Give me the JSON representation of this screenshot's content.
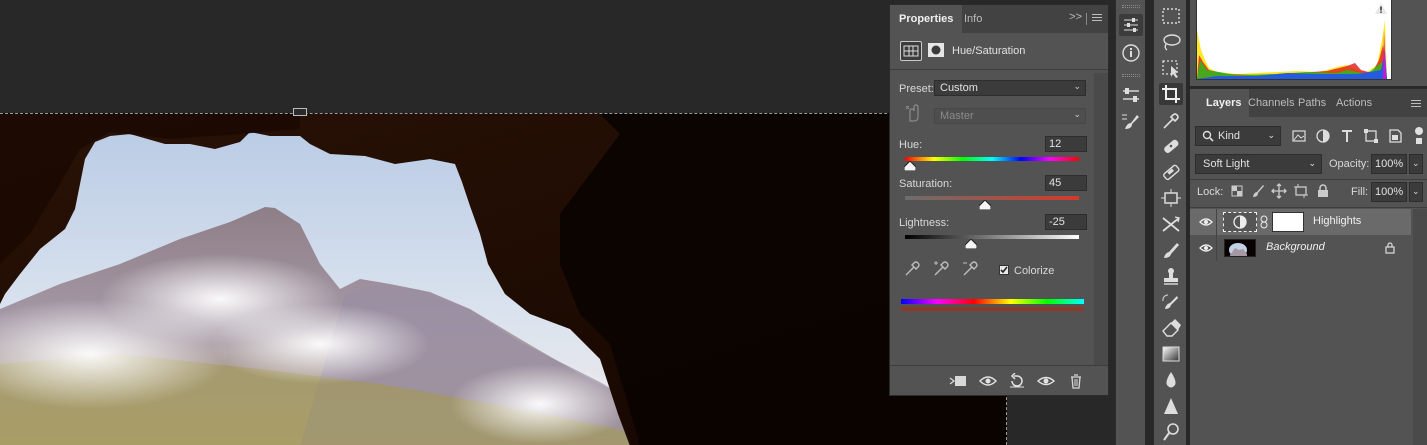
{
  "properties_panel": {
    "tabs": [
      "Properties",
      "Info"
    ],
    "collapse_glyph": ">>",
    "adjustment_title": "Hue/Saturation",
    "preset_label": "Preset:",
    "preset_value": "Custom",
    "channel_value": "Master",
    "hue": {
      "label": "Hue:",
      "value": "12",
      "fraction": 0.03
    },
    "saturation": {
      "label": "Saturation:",
      "value": "45",
      "fraction": 0.46
    },
    "lightness": {
      "label": "Lightness:",
      "value": "-25",
      "fraction": 0.38
    },
    "colorize_label": "Colorize",
    "colorize_checked": true
  },
  "layers_panel": {
    "tabs": [
      "Layers",
      "Channels",
      "Paths",
      "Actions"
    ],
    "kind_filter": "Kind",
    "blend_mode": "Soft Light",
    "opacity_label": "Opacity:",
    "opacity_value": "100%",
    "lock_label": "Lock:",
    "fill_label": "Fill:",
    "fill_value": "100%",
    "layers": [
      {
        "name": "Highlights",
        "selected": true,
        "visible": true,
        "type": "adjustment"
      },
      {
        "name": "Background",
        "selected": false,
        "visible": true,
        "type": "image",
        "locked": true
      }
    ]
  },
  "histogram": {
    "warning_icon": "warning-icon"
  },
  "colors": {
    "panel_bg": "#535353",
    "tab_bar_bg": "#424242",
    "pasteboard": "#282828",
    "field_bg": "#3b3b3b",
    "selected_layer_bg": "#6a6a6a",
    "colorized_swatch": "#8a3a26"
  }
}
